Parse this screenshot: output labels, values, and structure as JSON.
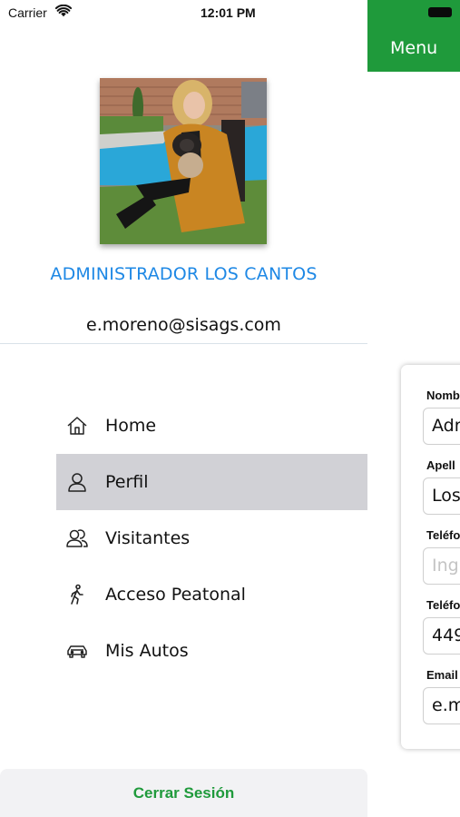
{
  "status_bar": {
    "carrier": "Carrier",
    "time": "12:01 PM",
    "wifi_icon": "wifi-icon",
    "battery_icon": "battery-icon"
  },
  "background_screen": {
    "header_title": "Menu",
    "header_color": "#1f9a3b",
    "form": {
      "fields": [
        {
          "label": "Nomb",
          "value": "Adr",
          "is_placeholder": false
        },
        {
          "label": "Apell",
          "value": "Los",
          "is_placeholder": false
        },
        {
          "label": "Teléfo",
          "value": "Ingr",
          "is_placeholder": true
        },
        {
          "label": "Teléfo",
          "value": "449",
          "is_placeholder": false
        },
        {
          "label": "Email",
          "value": "e.m",
          "is_placeholder": false
        }
      ]
    }
  },
  "drawer": {
    "profile": {
      "avatar": "profile-photo",
      "name": "ADMINISTRADOR LOS CANTOS",
      "email": "e.moreno@sisags.com",
      "name_color": "#1e88e5"
    },
    "menu": [
      {
        "label": "Home",
        "icon": "home-icon",
        "active": false
      },
      {
        "label": "Perfil",
        "icon": "user-icon",
        "active": true
      },
      {
        "label": "Visitantes",
        "icon": "users-icon",
        "active": false
      },
      {
        "label": "Acceso Peatonal",
        "icon": "walking-icon",
        "active": false
      },
      {
        "label": "Mis Autos",
        "icon": "car-icon",
        "active": false
      }
    ],
    "logout_label": "Cerrar Sesión",
    "accent_color": "#1f9a3b",
    "active_item_color": "#d1d1d6"
  }
}
